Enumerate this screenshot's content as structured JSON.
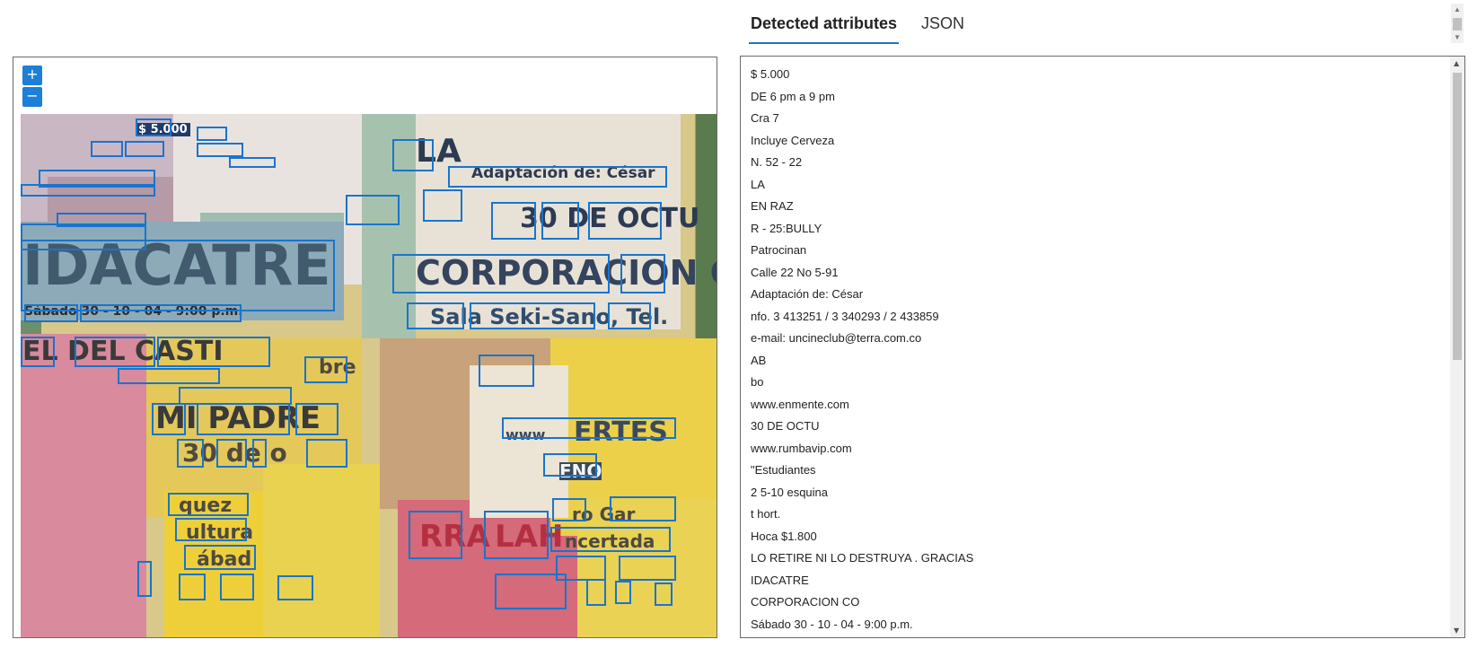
{
  "viewer": {
    "zoom_in_label": "+",
    "zoom_out_label": "−",
    "poster_texts": [
      "$ 5.000",
      "LA",
      "Adaptación de: César",
      "30 DE OCTU",
      "CORPORACION CO",
      "Sala Seki-Sano, Tel.",
      "IDACATRE",
      "Sábado 30 - 10 - 04 - 9:00 p.m.",
      "EL DEL CASTI",
      "MI PADRE",
      "30 de o",
      "bre",
      "quez",
      "ultura",
      "ábad",
      "RRA",
      "LAH",
      "ncertada",
      "ro Gar",
      "ENO",
      "www",
      "ERTES"
    ]
  },
  "tabs": {
    "active_label": "Detected attributes",
    "json_label": "JSON"
  },
  "attributes": [
    "$ 5.000",
    "DE 6 pm a 9 pm",
    "Cra 7",
    "Incluye Cerveza",
    "N. 52 - 22",
    "LA",
    "EN RAZ",
    "R - 25:BULLY",
    "Patrocinan",
    "Calle 22 No 5-91",
    "Adaptación de: César",
    "nfo. 3 413251 / 3 340293 / 2 433859",
    "e-mail: uncineclub@terra.com.co",
    "AB",
    "bo",
    "www.enmente.com",
    "30 DE OCTU",
    "www.rumbavip.com",
    "\"Estudiantes",
    "2 5-10 esquina",
    "t hort.",
    "Hoca $1.800",
    "LO RETIRE NI LO DESTRUYA . GRACIAS",
    "IDACATRE",
    "CORPORACION CO",
    "Sábado 30 - 10 - 04 - 9:00 p.m.",
    "Sala Seki-Sano, Tel."
  ]
}
